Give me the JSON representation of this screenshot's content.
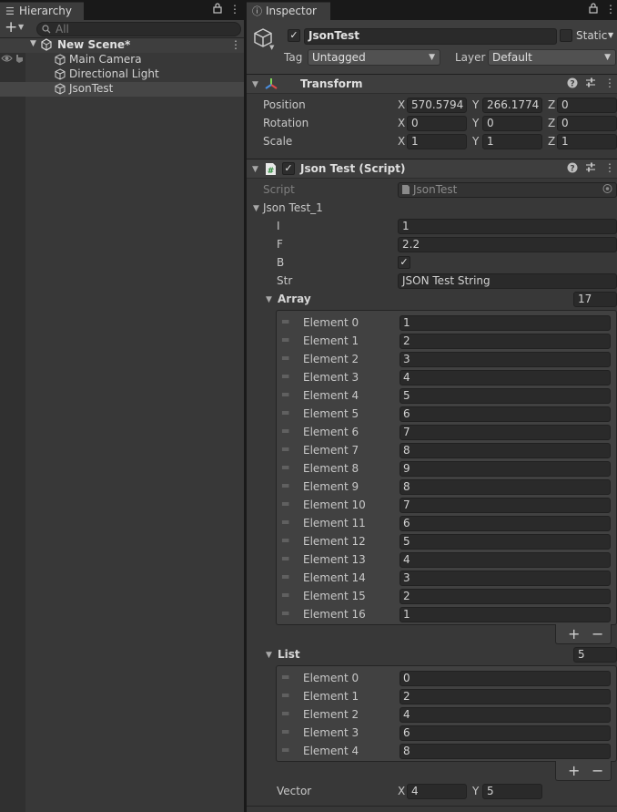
{
  "hierarchy": {
    "tab_label": "Hierarchy",
    "search_placeholder": "All",
    "scene_name": "New Scene*",
    "items": [
      "Main Camera",
      "Directional Light",
      "JsonTest"
    ]
  },
  "inspector": {
    "tab_label": "Inspector",
    "object_name": "JsonTest",
    "static_label": "Static",
    "tag_label": "Tag",
    "tag_value": "Untagged",
    "layer_label": "Layer",
    "layer_value": "Default",
    "transform": {
      "title": "Transform",
      "position_label": "Position",
      "rotation_label": "Rotation",
      "scale_label": "Scale",
      "x": "X",
      "y": "Y",
      "z": "Z",
      "position": [
        "570.5794",
        "266.1774",
        "0"
      ],
      "rotation": [
        "0",
        "0",
        "0"
      ],
      "scale": [
        "1",
        "1",
        "1"
      ]
    },
    "script_component": {
      "title": "Json Test (Script)",
      "script_label": "Script",
      "script_value": "JsonTest",
      "group_label": "Json Test_1",
      "i_label": "I",
      "i_value": "1",
      "f_label": "F",
      "f_value": "2.2",
      "b_label": "B",
      "b_checked": true,
      "str_label": "Str",
      "str_value": "JSON Test String",
      "array_label": "Array",
      "array_size": "17",
      "array_elements": [
        {
          "name": "Element 0",
          "value": "1"
        },
        {
          "name": "Element 1",
          "value": "2"
        },
        {
          "name": "Element 2",
          "value": "3"
        },
        {
          "name": "Element 3",
          "value": "4"
        },
        {
          "name": "Element 4",
          "value": "5"
        },
        {
          "name": "Element 5",
          "value": "6"
        },
        {
          "name": "Element 6",
          "value": "7"
        },
        {
          "name": "Element 7",
          "value": "8"
        },
        {
          "name": "Element 8",
          "value": "9"
        },
        {
          "name": "Element 9",
          "value": "8"
        },
        {
          "name": "Element 10",
          "value": "7"
        },
        {
          "name": "Element 11",
          "value": "6"
        },
        {
          "name": "Element 12",
          "value": "5"
        },
        {
          "name": "Element 13",
          "value": "4"
        },
        {
          "name": "Element 14",
          "value": "3"
        },
        {
          "name": "Element 15",
          "value": "2"
        },
        {
          "name": "Element 16",
          "value": "1"
        }
      ],
      "list_label": "List",
      "list_size": "5",
      "list_elements": [
        {
          "name": "Element 0",
          "value": "0"
        },
        {
          "name": "Element 1",
          "value": "2"
        },
        {
          "name": "Element 2",
          "value": "4"
        },
        {
          "name": "Element 3",
          "value": "6"
        },
        {
          "name": "Element 4",
          "value": "8"
        }
      ],
      "vector_label": "Vector",
      "vector_x": "4",
      "vector_y": "5"
    }
  },
  "symbols": {
    "plus": "+",
    "minus": "−",
    "checkmark": "✓",
    "lock": "🔒",
    "kebab": "⋮",
    "caret": "▾"
  }
}
